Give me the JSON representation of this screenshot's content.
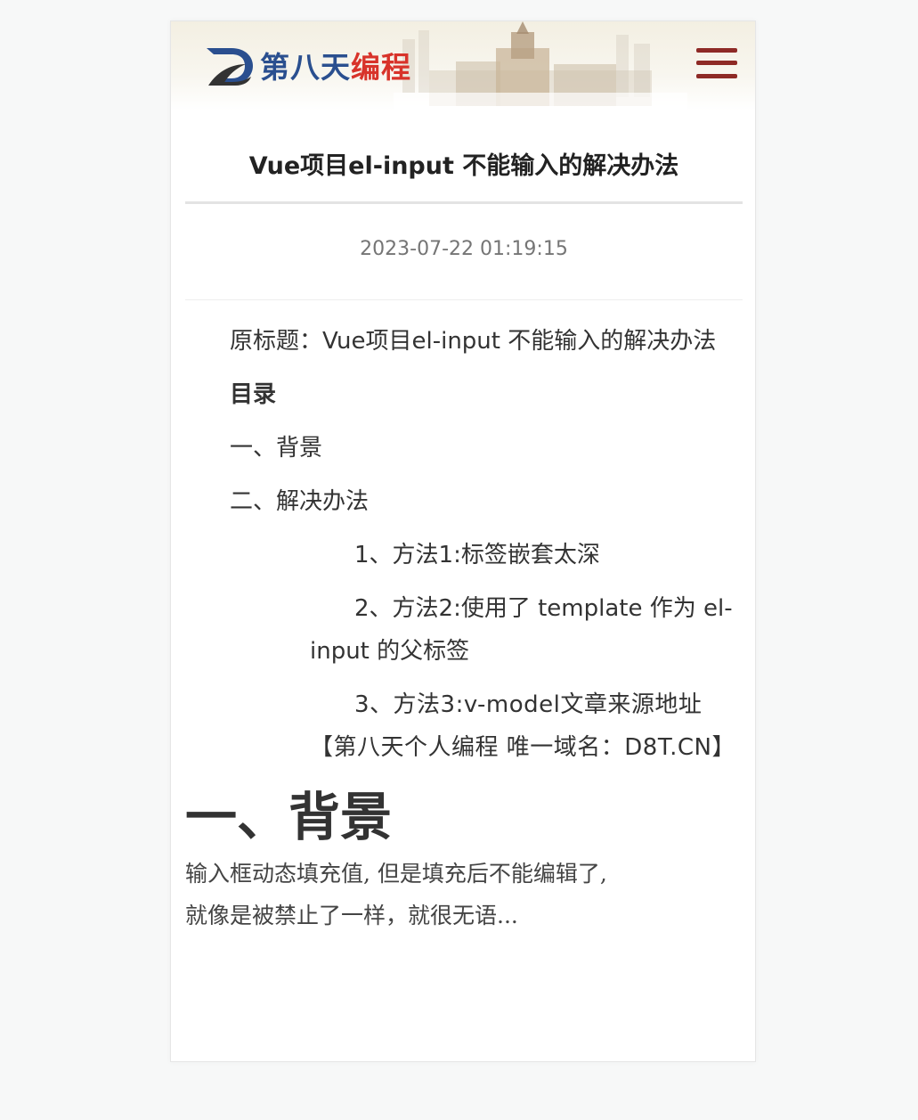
{
  "header": {
    "logo_text_blue": "第八天",
    "logo_text_red": "编程",
    "menu_icon": "hamburger-menu-icon",
    "accent_color": "#8e2a26"
  },
  "article": {
    "title": "Vue项目el-input 不能输入的解决办法",
    "date": "2023-07-22 01:19:15",
    "original_title": "原标题：Vue项目el-input 不能输入的解决办法",
    "toc_heading": "目录",
    "toc": [
      "一、背景",
      "二、解决办法"
    ],
    "toc_sub": [
      "1、方法1:标签嵌套太深",
      "2、方法2:使用了 template 作为 el-input 的父标签",
      "3、方法3:v-model文章来源地址【第八天个人编程 唯一域名：D8T.CN】"
    ],
    "section_heading": "一、背景",
    "section_lines": [
      "输入框动态填充值, 但是填充后不能编辑了,",
      "就像是被禁止了一样，就很无语..."
    ]
  }
}
